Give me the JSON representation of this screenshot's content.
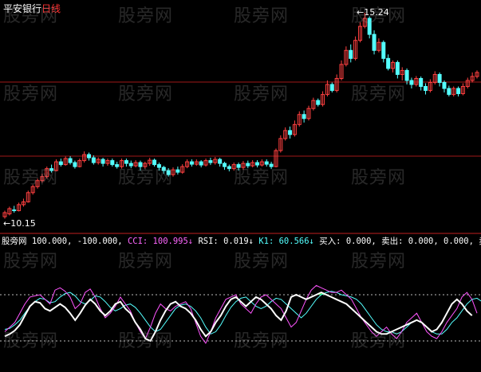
{
  "window": {
    "stock_name": "平安银行",
    "period": "日线"
  },
  "price_panel": {
    "high_label": "15.24",
    "low_label": "10.15",
    "up_color": "#ff4040",
    "down_color": "#54ffff",
    "ma_color": "#ffffff"
  },
  "indicator_bar": {
    "source": "股旁网",
    "items": [
      {
        "text": "100.000,",
        "color": "#ffffff"
      },
      {
        "text": "-100.000,",
        "color": "#ffffff"
      },
      {
        "text": "CCI: 100.995↓",
        "color": "#ff66ff"
      },
      {
        "text": "RSI: 0.019↓",
        "color": "#ffffff"
      },
      {
        "text": "K1: 60.566↓",
        "color": "#54ffff"
      },
      {
        "text": "买入: 0.000,",
        "color": "#ffffff"
      },
      {
        "text": "卖出: 0.000,",
        "color": "#ffffff"
      },
      {
        "text": "0.000,",
        "color": "#ffffff"
      },
      {
        "text": "卖",
        "color": "#ffffff"
      }
    ]
  },
  "watermark": "股旁网",
  "chart_data": {
    "type": "candlestick",
    "price_range": [
      10.15,
      15.24
    ],
    "candles": [
      [
        10.15,
        10.25,
        10.1,
        10.3
      ],
      [
        10.22,
        10.35,
        10.18,
        10.4
      ],
      [
        10.32,
        10.3,
        10.25,
        10.42
      ],
      [
        10.3,
        10.45,
        10.28,
        10.5
      ],
      [
        10.45,
        10.52,
        10.4,
        10.6
      ],
      [
        10.52,
        10.75,
        10.5,
        10.8
      ],
      [
        10.75,
        10.9,
        10.7,
        10.95
      ],
      [
        10.9,
        11.05,
        10.85,
        11.1
      ],
      [
        11.05,
        11.15,
        11.0,
        11.22
      ],
      [
        11.15,
        11.35,
        11.1,
        11.4
      ],
      [
        11.35,
        11.3,
        11.25,
        11.45
      ],
      [
        11.3,
        11.52,
        11.28,
        11.58
      ],
      [
        11.52,
        11.45,
        11.4,
        11.6
      ],
      [
        11.45,
        11.6,
        11.42,
        11.65
      ],
      [
        11.6,
        11.5,
        11.45,
        11.66
      ],
      [
        11.5,
        11.4,
        11.35,
        11.55
      ],
      [
        11.4,
        11.55,
        11.38,
        11.6
      ],
      [
        11.55,
        11.7,
        11.5,
        11.78
      ],
      [
        11.7,
        11.62,
        11.55,
        11.75
      ],
      [
        11.62,
        11.5,
        11.45,
        11.68
      ],
      [
        11.5,
        11.58,
        11.45,
        11.63
      ],
      [
        11.58,
        11.48,
        11.4,
        11.62
      ],
      [
        11.48,
        11.55,
        11.42,
        11.6
      ],
      [
        11.55,
        11.45,
        11.4,
        11.6
      ],
      [
        11.45,
        11.4,
        11.35,
        11.52
      ],
      [
        11.4,
        11.55,
        11.35,
        11.6
      ],
      [
        11.55,
        11.48,
        11.4,
        11.6
      ],
      [
        11.48,
        11.42,
        11.36,
        11.55
      ],
      [
        11.42,
        11.5,
        11.38,
        11.56
      ],
      [
        11.5,
        11.4,
        11.3,
        11.55
      ],
      [
        11.4,
        11.48,
        11.35,
        11.52
      ],
      [
        11.48,
        11.56,
        11.42,
        11.62
      ],
      [
        11.56,
        11.45,
        11.4,
        11.6
      ],
      [
        11.45,
        11.38,
        11.3,
        11.5
      ],
      [
        11.38,
        11.3,
        11.22,
        11.42
      ],
      [
        11.3,
        11.2,
        11.15,
        11.36
      ],
      [
        11.2,
        11.32,
        11.15,
        11.38
      ],
      [
        11.32,
        11.26,
        11.2,
        11.4
      ],
      [
        11.26,
        11.4,
        11.22,
        11.46
      ],
      [
        11.4,
        11.52,
        11.36,
        11.58
      ],
      [
        11.52,
        11.46,
        11.4,
        11.58
      ],
      [
        11.46,
        11.52,
        11.42,
        11.58
      ],
      [
        11.52,
        11.44,
        11.38,
        11.56
      ],
      [
        11.44,
        11.55,
        11.4,
        11.6
      ],
      [
        11.55,
        11.5,
        11.44,
        11.62
      ],
      [
        11.5,
        11.58,
        11.45,
        11.64
      ],
      [
        11.58,
        11.48,
        11.4,
        11.62
      ],
      [
        11.48,
        11.4,
        11.32,
        11.52
      ],
      [
        11.4,
        11.35,
        11.28,
        11.45
      ],
      [
        11.35,
        11.45,
        11.3,
        11.5
      ],
      [
        11.45,
        11.38,
        11.3,
        11.5
      ],
      [
        11.38,
        11.48,
        11.32,
        11.54
      ],
      [
        11.48,
        11.42,
        11.36,
        11.55
      ],
      [
        11.42,
        11.5,
        11.38,
        11.56
      ],
      [
        11.5,
        11.44,
        11.38,
        11.56
      ],
      [
        11.44,
        11.52,
        11.4,
        11.58
      ],
      [
        11.52,
        11.46,
        11.4,
        11.58
      ],
      [
        11.46,
        11.4,
        11.34,
        11.52
      ],
      [
        11.4,
        11.8,
        11.38,
        11.85
      ],
      [
        11.8,
        12.1,
        11.75,
        12.18
      ],
      [
        12.1,
        12.3,
        12.05,
        12.38
      ],
      [
        12.3,
        12.2,
        12.1,
        12.4
      ],
      [
        12.2,
        12.45,
        12.15,
        12.55
      ],
      [
        12.45,
        12.7,
        12.4,
        12.78
      ],
      [
        12.7,
        12.6,
        12.5,
        12.8
      ],
      [
        12.6,
        12.85,
        12.55,
        12.92
      ],
      [
        12.85,
        13.05,
        12.8,
        13.12
      ],
      [
        13.05,
        12.95,
        12.9,
        13.1
      ],
      [
        12.95,
        13.2,
        12.9,
        13.28
      ],
      [
        13.2,
        13.45,
        13.15,
        13.55
      ],
      [
        13.45,
        13.3,
        13.25,
        13.5
      ],
      [
        13.3,
        13.6,
        13.25,
        13.7
      ],
      [
        13.6,
        13.95,
        13.55,
        14.05
      ],
      [
        13.95,
        14.3,
        13.9,
        14.4
      ],
      [
        14.3,
        14.1,
        14.0,
        14.45
      ],
      [
        14.1,
        14.55,
        14.05,
        14.65
      ],
      [
        14.55,
        14.9,
        14.5,
        15.0
      ],
      [
        14.9,
        15.1,
        14.85,
        15.24
      ],
      [
        15.1,
        14.7,
        14.6,
        15.15
      ],
      [
        14.7,
        14.3,
        14.2,
        14.8
      ],
      [
        14.3,
        14.5,
        14.25,
        14.6
      ],
      [
        14.5,
        14.1,
        14.0,
        14.55
      ],
      [
        14.1,
        13.85,
        13.8,
        14.2
      ],
      [
        13.85,
        14.0,
        13.75,
        14.05
      ],
      [
        14.0,
        13.7,
        13.6,
        14.05
      ],
      [
        13.7,
        13.8,
        13.55,
        13.88
      ],
      [
        13.8,
        13.55,
        13.45,
        13.85
      ],
      [
        13.55,
        13.45,
        13.35,
        13.62
      ],
      [
        13.45,
        13.6,
        13.4,
        13.66
      ],
      [
        13.6,
        13.4,
        13.3,
        13.65
      ],
      [
        13.4,
        13.3,
        13.2,
        13.48
      ],
      [
        13.3,
        13.5,
        13.25,
        13.58
      ],
      [
        13.5,
        13.7,
        13.45,
        13.78
      ],
      [
        13.7,
        13.5,
        13.4,
        13.75
      ],
      [
        13.5,
        13.35,
        13.25,
        13.55
      ],
      [
        13.35,
        13.2,
        13.15,
        13.42
      ],
      [
        13.2,
        13.35,
        13.15,
        13.4
      ],
      [
        13.35,
        13.22,
        13.15,
        13.4
      ],
      [
        13.22,
        13.4,
        13.18,
        13.48
      ],
      [
        13.4,
        13.55,
        13.35,
        13.62
      ],
      [
        13.55,
        13.65,
        13.5,
        13.75
      ],
      [
        13.65,
        13.75,
        13.6,
        13.8
      ]
    ],
    "indicator": {
      "levels": [
        100,
        -100
      ],
      "cci": [
        -60,
        -40,
        -20,
        20,
        60,
        90,
        95,
        100,
        80,
        60,
        120,
        130,
        115,
        90,
        40,
        60,
        110,
        125,
        90,
        40,
        0,
        20,
        50,
        90,
        60,
        30,
        -20,
        -60,
        -90,
        -40,
        20,
        60,
        40,
        30,
        50,
        60,
        70,
        40,
        -20,
        -80,
        -110,
        -60,
        0,
        40,
        80,
        90,
        100,
        60,
        40,
        20,
        60,
        90,
        100,
        80,
        60,
        40,
        0,
        -40,
        -20,
        30,
        80,
        120,
        140,
        130,
        120,
        110,
        110,
        120,
        100,
        80,
        40,
        0,
        -30,
        -60,
        -80,
        -60,
        -40,
        -70,
        -90,
        -60,
        -20,
        0,
        20,
        -20,
        -60,
        -80,
        -90,
        -60,
        -20,
        10,
        40,
        90,
        110,
        80,
        20
      ],
      "k1": [
        -50,
        -45,
        -30,
        -10,
        20,
        50,
        70,
        85,
        80,
        65,
        70,
        90,
        105,
        110,
        95,
        70,
        60,
        75,
        95,
        90,
        70,
        45,
        30,
        40,
        55,
        60,
        45,
        20,
        -10,
        -40,
        -60,
        -50,
        -20,
        10,
        40,
        55,
        60,
        50,
        30,
        0,
        -40,
        -70,
        -60,
        -30,
        10,
        45,
        70,
        85,
        90,
        70,
        50,
        40,
        50,
        70,
        85,
        80,
        60,
        40,
        20,
        0,
        20,
        50,
        80,
        100,
        110,
        115,
        110,
        100,
        95,
        90,
        80,
        60,
        30,
        0,
        -30,
        -50,
        -60,
        -60,
        -70,
        -60,
        -40,
        -20,
        -10,
        -20,
        -40,
        -60,
        -70,
        -70,
        -50,
        -20,
        0,
        30,
        60,
        80,
        85,
        70
      ],
      "white": [
        -80,
        -70,
        -55,
        -30,
        10,
        50,
        70,
        65,
        40,
        30,
        45,
        60,
        45,
        20,
        -10,
        20,
        55,
        80,
        60,
        30,
        10,
        30,
        60,
        70,
        40,
        20,
        -20,
        -50,
        -90,
        -100,
        -60,
        -10,
        30,
        60,
        70,
        50,
        40,
        20,
        -10,
        -50,
        -80,
        -60,
        -20,
        10,
        50,
        80,
        90,
        70,
        50,
        70,
        90,
        80,
        60,
        40,
        10,
        -10,
        30,
        90,
        100,
        90,
        80,
        90,
        100,
        110,
        100,
        90,
        80,
        70,
        60,
        40,
        20,
        0,
        -20,
        -40,
        -60,
        -70,
        -70,
        -60,
        -50,
        -40,
        -30,
        -20,
        -10,
        -20,
        -40,
        -60,
        -50,
        -20,
        20,
        60,
        80,
        60,
        30,
        10
      ]
    }
  }
}
